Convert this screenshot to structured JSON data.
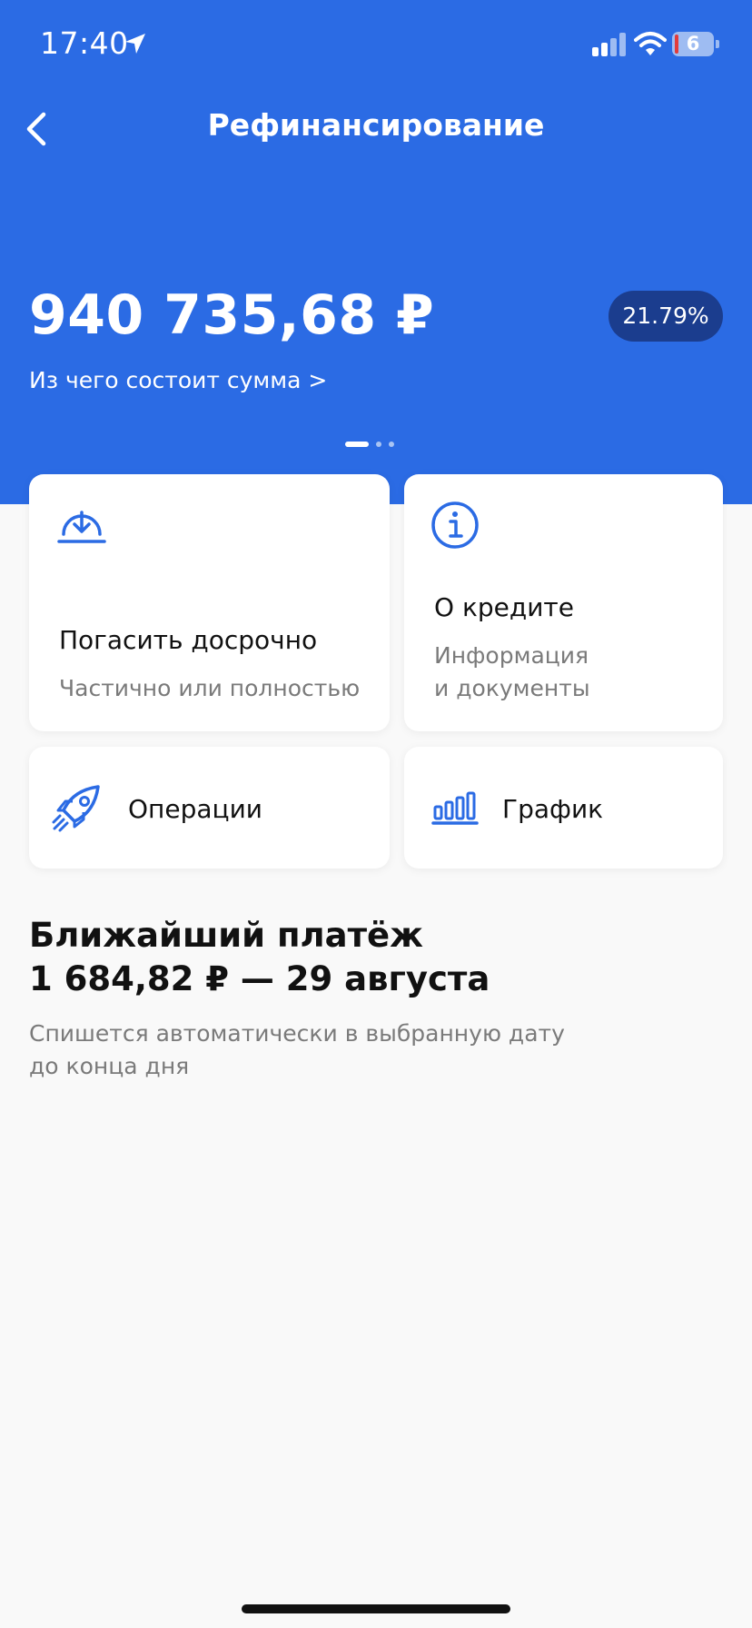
{
  "status_bar": {
    "time": "17:40",
    "battery_level": "6"
  },
  "header": {
    "title": "Рефинансирование",
    "balance": "940 735,68 ₽",
    "rate": "21.79%",
    "breakdown_link": "Из чего состоит сумма >",
    "pager": {
      "pages": 3,
      "active": 1
    }
  },
  "actions": {
    "repay": {
      "title": "Погасить досрочно",
      "subtitle": "Частично или полностью",
      "icon": "download-icon"
    },
    "about": {
      "title": "О кредите",
      "subtitle_line1": "Информация",
      "subtitle_line2": "и документы",
      "icon": "info-icon"
    },
    "operations": {
      "title": "Операции",
      "icon": "rocket-icon"
    },
    "schedule": {
      "title": "График",
      "icon": "bar-chart-icon"
    }
  },
  "next_payment": {
    "heading": "Ближайший платёж",
    "amount_date": "1 684,82 ₽ — 29 августа",
    "note_line1": "Спишется автоматически в выбранную дату",
    "note_line2": "до конца дня"
  },
  "colors": {
    "accent": "#2b6be4",
    "badge": "#1b3d8e",
    "background": "#f9f9f9",
    "muted_text": "#7a7a7a"
  }
}
